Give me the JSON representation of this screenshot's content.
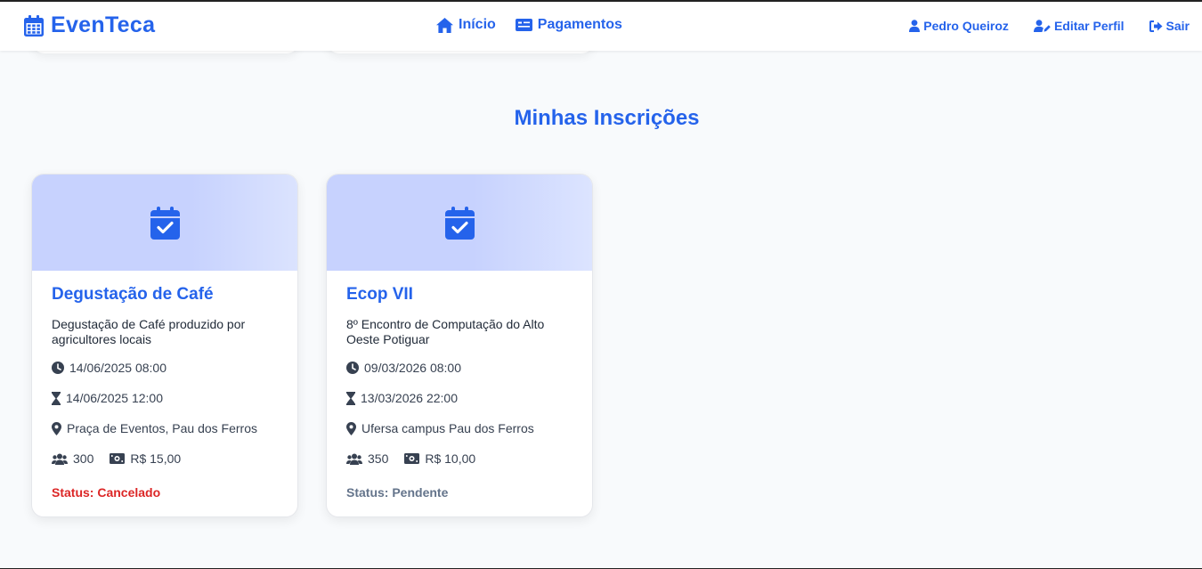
{
  "app": {
    "brand": "EvenTeca",
    "brand_icon": "calendar-icon",
    "accent_color": "#2563eb"
  },
  "nav": {
    "home_label": "Início",
    "payments_label": "Pagamentos",
    "user_name": "Pedro Queiroz",
    "edit_profile_label": "Editar Perfil",
    "logout_label": "Sair"
  },
  "main": {
    "section_title": "Minhas Inscrições",
    "registrations": [
      {
        "title": "Degustação de Café",
        "description": "Degustação de Café produzido por agricultores locais",
        "start": "14/06/2025 08:00",
        "end": "14/06/2025 12:00",
        "location": "Praça de Eventos, Pau dos Ferros",
        "capacity": "300",
        "price": "R$ 15,00",
        "status": "Status: Cancelado",
        "status_color": "#dc2626"
      },
      {
        "title": "Ecop VII",
        "description": "8º Encontro de Computação do Alto Oeste Potiguar",
        "start": "09/03/2026 08:00",
        "end": "13/03/2026 22:00",
        "location": "Ufersa campus Pau dos Ferros",
        "capacity": "350",
        "price": "R$ 10,00",
        "status": "Status: Pendente",
        "status_color": "#64748b"
      }
    ]
  }
}
